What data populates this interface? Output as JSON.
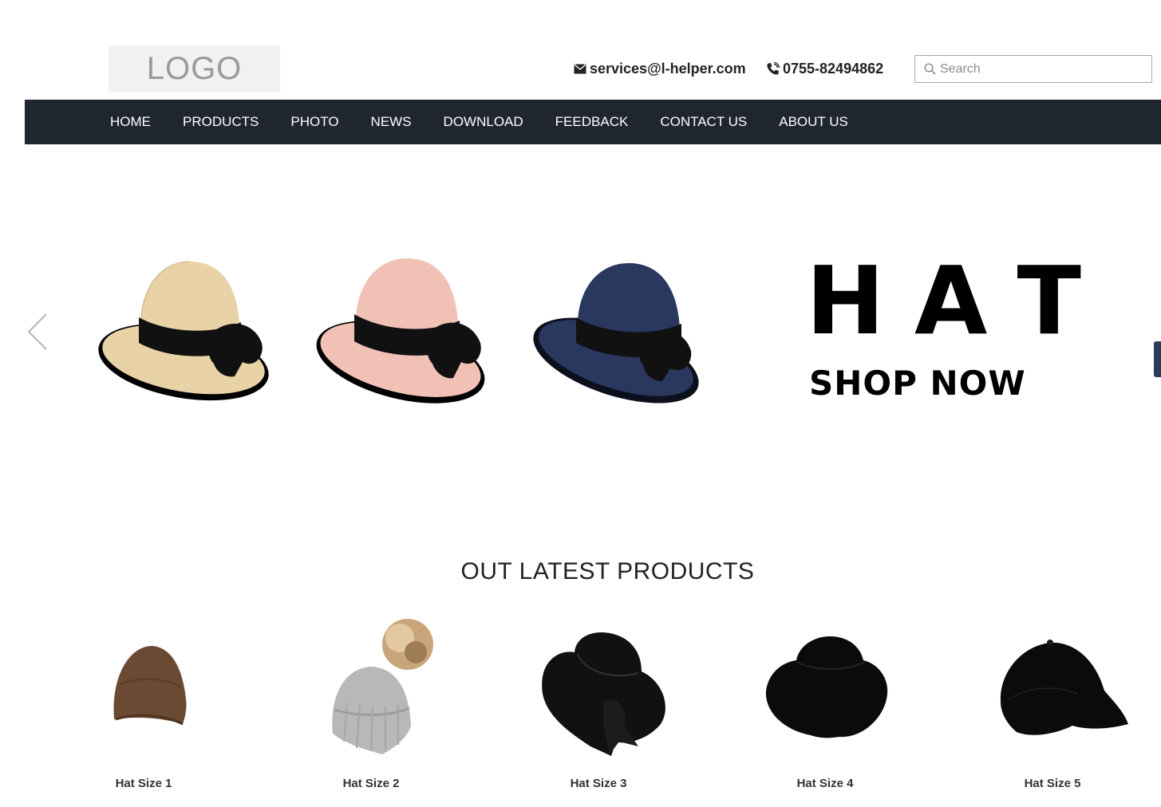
{
  "header": {
    "logo_text": "LOGO",
    "email": "services@l-helper.com",
    "phone": "0755-82494862",
    "search_placeholder": "Search"
  },
  "nav": {
    "items": [
      "HOME",
      "PRODUCTS",
      "PHOTO",
      "NEWS",
      "DOWNLOAD",
      "FEEDBACK",
      "CONTACT US",
      "ABOUT US"
    ]
  },
  "banner": {
    "headline_letters": [
      "H",
      "A",
      "T"
    ],
    "cta": "SHOP NOW",
    "hat_colors": [
      "#e8d2a6",
      "#f2c1b6",
      "#2a3860"
    ]
  },
  "products_section": {
    "title": "OUT LATEST PRODUCTS",
    "items": [
      {
        "name": "Hat Size 1",
        "icon": "beanie-brown-icon"
      },
      {
        "name": "Hat Size 2",
        "icon": "beanie-pompom-icon"
      },
      {
        "name": "Hat Size 3",
        "icon": "bow-sun-hat-icon"
      },
      {
        "name": "Hat Size 4",
        "icon": "bucket-hat-icon"
      },
      {
        "name": "Hat Size 5",
        "icon": "baseball-cap-icon"
      }
    ]
  }
}
